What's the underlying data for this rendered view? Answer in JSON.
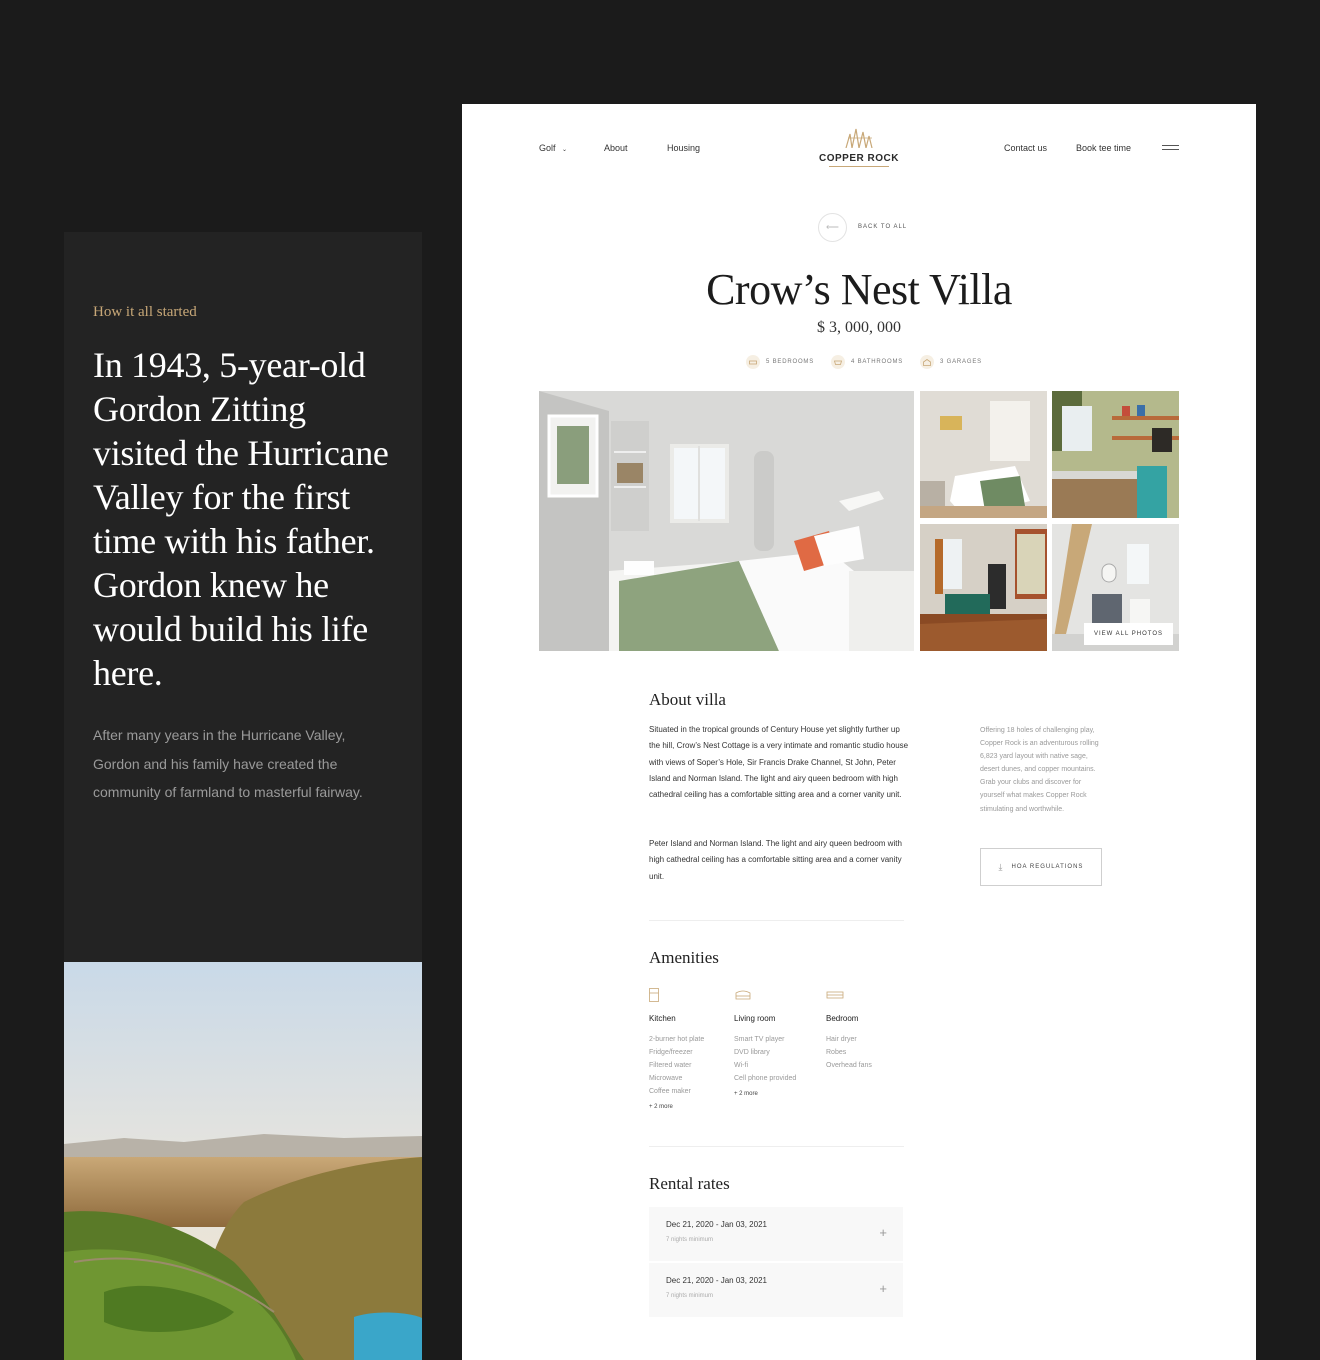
{
  "story": {
    "eyebrow": "How it all started",
    "headline": "In 1943, 5-year-old Gordon Zitting visited the Hurricane Valley for the first time with his father. Gordon knew he would build his life here.",
    "paragraph": "After many years in the Hurricane Valley, Gordon and his family have created the community of farmland to masterful fairway."
  },
  "nav": {
    "golf": "Golf",
    "about": "About",
    "housing": "Housing",
    "logo": "COPPER ROCK",
    "contact": "Contact us",
    "book": "Book tee time",
    "back": "BACK TO ALL"
  },
  "villa": {
    "title": "Crow’s Nest Villa",
    "price": "$ 3, 000, 000",
    "specs": [
      "5 BEDROOMS",
      "4 BATHROOMS",
      "3 GARAGES"
    ],
    "view_all": "VIEW ALL PHOTOS"
  },
  "about": {
    "title": "About villa",
    "p1": "Situated in the tropical grounds of Century House yet slightly further up the hill, Crow’s Nest Cottage is a very intimate and romantic studio house with views of Soper’s Hole, Sir Francis Drake Channel, St John, Peter Island and Norman Island. The light and airy queen bedroom with high cathedral ceiling has a comfortable sitting area and a corner vanity unit.",
    "p2": "Peter Island and Norman Island. The light and airy queen bedroom with high cathedral ceiling has a comfortable sitting area and a corner vanity unit.",
    "aside": "Offering 18 holes of challenging play, Copper Rock is an adventurous rolling 6,823 yard layout with native sage, desert dunes, and copper mountains. Grab your clubs and discover for yourself what makes Copper Rock stimulating and worthwhile.",
    "hoa": "HOA REGULATIONS"
  },
  "amenities": {
    "title": "Amenities",
    "groups": [
      {
        "name": "Kitchen",
        "items": [
          "2-burner hot plate",
          "Fridge/freezer",
          "Filtered water",
          "Microwave",
          "Coffee maker"
        ],
        "more": "2 more"
      },
      {
        "name": "Living room",
        "items": [
          "Smart TV player",
          "DVD library",
          "Wi-fi",
          "Cell phone provided"
        ],
        "more": "2 more"
      },
      {
        "name": "Bedroom",
        "items": [
          "Hair dryer",
          "Robes",
          "Overhead fans"
        ],
        "more": ""
      }
    ]
  },
  "rates": {
    "title": "Rental rates",
    "rows": [
      {
        "dates": "Dec 21, 2020 - Jan 03, 2021",
        "nights": "7 nights minimum"
      },
      {
        "dates": "Dec 21, 2020 - Jan 03, 2021",
        "nights": "7 nights minimum"
      }
    ]
  },
  "colors": {
    "background": "#1b1b1b",
    "card": "#232323",
    "accent_gold": "#c8a878",
    "page": "#ffffff"
  },
  "icons": [
    "chevron-down-icon",
    "menu-icon",
    "arrow-left-icon",
    "bed-icon",
    "bath-icon",
    "garage-icon",
    "download-icon",
    "fridge-icon",
    "sofa-icon",
    "bed-outline-icon",
    "plus-icon"
  ]
}
